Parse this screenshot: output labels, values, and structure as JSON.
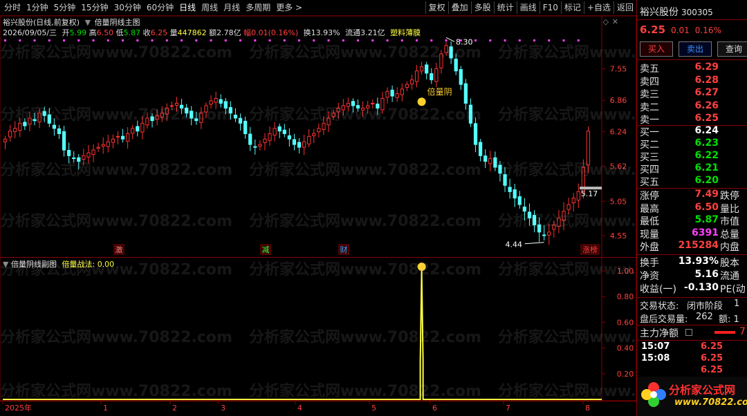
{
  "toolbar": {
    "periods": [
      "分时",
      "1分钟",
      "5分钟",
      "15分钟",
      "30分钟",
      "60分钟",
      "日线",
      "周线",
      "月线",
      "多周期",
      "更多 >"
    ],
    "active_period": "日线",
    "buttons": [
      "复权",
      "叠加",
      "多股",
      "统计",
      "画线",
      "F10",
      "标记",
      "+自选",
      "返回"
    ]
  },
  "main_chart": {
    "title": "裕兴股份(日线,前复权)",
    "indicator_title": "倍量阴线主图",
    "info": {
      "date": "2026/09/05/三",
      "open_label": "开",
      "open": "5.99",
      "high_label": "高",
      "high": "6.50",
      "low_label": "低",
      "low": "5.87",
      "close_label": "收",
      "close": "6.25",
      "volume_label": "量",
      "volume": "447862",
      "amount_label": "额",
      "amount": "2.78亿",
      "change_label": "幅",
      "change": "0.01(0.16%)",
      "turnover_label": "换",
      "turnover": "13.93%",
      "float_label": "流通",
      "float": "3.21亿",
      "concept": "塑料薄膜"
    },
    "y_ticks": [
      "7.55",
      "6.86",
      "6.24",
      "5.62",
      "5.05",
      "4.55"
    ],
    "annotations": {
      "high_mark": "8.30",
      "low_mark": "4.44",
      "signal_label": "倍量阴",
      "current_price_tag": "5.17"
    },
    "event_markers": [
      "激",
      "减",
      "财",
      "涨榜"
    ]
  },
  "sub_chart": {
    "title": "倍量阴线副图",
    "indicator_label": "倍量战法:",
    "indicator_value": "0.00",
    "y_ticks": [
      "1.00",
      "0.80",
      "0.60",
      "0.40",
      "0.20"
    ]
  },
  "x_axis": {
    "labels": [
      "2025年",
      "1",
      "2",
      "3",
      "4",
      "5",
      "6",
      "7",
      "8"
    ]
  },
  "right_panel": {
    "name": "裕兴股份",
    "code": "300305",
    "price": "6.25",
    "change": "0.01",
    "change_pct": "0.16%",
    "buy_label": "买入",
    "sell_label": "卖出",
    "query_label": "查询",
    "asks": [
      {
        "label": "卖五",
        "price": "6.29"
      },
      {
        "label": "卖四",
        "price": "6.28"
      },
      {
        "label": "卖三",
        "price": "6.27"
      },
      {
        "label": "卖二",
        "price": "6.26"
      },
      {
        "label": "卖一",
        "price": "6.25"
      }
    ],
    "bids": [
      {
        "label": "买一",
        "price": "6.24"
      },
      {
        "label": "买二",
        "price": "6.23"
      },
      {
        "label": "买三",
        "price": "6.22"
      },
      {
        "label": "买四",
        "price": "6.21"
      },
      {
        "label": "买五",
        "price": "6.20"
      }
    ],
    "stats": [
      {
        "label": "涨停",
        "value": "7.49",
        "label2": "跌停"
      },
      {
        "label": "最高",
        "value": "6.50",
        "label2": "量比"
      },
      {
        "label": "最低",
        "value": "5.87",
        "label2": "市值"
      },
      {
        "label": "现量",
        "value": "6391",
        "label2": "总量"
      },
      {
        "label": "外盘",
        "value": "215284",
        "label2": "内盘"
      }
    ],
    "stats2": [
      {
        "label": "换手",
        "value": "13.93%",
        "label2": "股本"
      },
      {
        "label": "净资",
        "value": "5.16",
        "label2": "流通"
      },
      {
        "label": "收益(一)",
        "value": "-0.130",
        "label2": "PE(动"
      }
    ],
    "trade_status_label": "交易状态:",
    "trade_status": "闭市阶段",
    "trade_status_tail": "1",
    "after_hours_label": "盘后交易量:",
    "after_hours_volume": "262",
    "after_hours_tail": "额: 1",
    "net_flow_label": "主力净额",
    "net_flow_tail": "7",
    "ticks": [
      {
        "time": "15:07",
        "price": "6.25"
      },
      {
        "time": "15:08",
        "price": "6.25"
      },
      {
        "time": "",
        "price": "6.25"
      }
    ],
    "logo_text": "分析家公式网",
    "logo_url": "www.70822.com"
  },
  "watermark": "分析家公式网www.70822.com",
  "chart_data": {
    "type": "candlestick",
    "title": "裕兴股份(日线,前复权)",
    "ylim": [
      4.3,
      8.5
    ],
    "y_scale": "log",
    "x_labels": [
      "2025年",
      "1",
      "2",
      "3",
      "4",
      "5",
      "6",
      "7",
      "8"
    ],
    "candles_close": [
      6.1,
      6.25,
      6.3,
      6.4,
      6.35,
      6.5,
      6.45,
      6.6,
      6.55,
      6.4,
      6.3,
      6.2,
      5.9,
      5.8,
      5.75,
      5.7,
      5.8,
      5.85,
      5.9,
      5.95,
      6.0,
      6.05,
      6.1,
      6.15,
      6.1,
      6.2,
      6.3,
      6.25,
      6.4,
      6.5,
      6.45,
      6.55,
      6.6,
      6.7,
      6.75,
      6.8,
      6.7,
      6.6,
      6.5,
      6.45,
      6.6,
      6.75,
      6.85,
      6.9,
      6.8,
      6.7,
      6.6,
      6.5,
      6.4,
      6.2,
      6.0,
      5.95,
      6.0,
      6.1,
      6.2,
      6.3,
      6.25,
      6.2,
      6.1,
      6.0,
      5.95,
      6.05,
      6.15,
      6.2,
      6.3,
      6.4,
      6.5,
      6.6,
      6.7,
      6.75,
      6.8,
      6.75,
      6.7,
      6.7,
      6.75,
      6.8,
      6.7,
      6.9,
      7.05,
      6.95,
      7.0,
      7.1,
      7.2,
      7.3,
      7.5,
      7.6,
      7.45,
      7.3,
      7.55,
      7.9,
      8.1,
      7.8,
      7.5,
      7.2,
      6.8,
      6.4,
      6.0,
      5.8,
      5.7,
      5.75,
      5.6,
      5.5,
      5.3,
      5.2,
      5.1,
      5.0,
      4.9,
      4.8,
      4.7,
      4.6,
      4.55,
      4.6,
      4.7,
      4.8,
      4.9,
      5.0,
      5.1,
      5.2,
      5.6,
      6.25
    ],
    "annotations": {
      "max": 8.3,
      "min": 4.44,
      "signal": "倍量阴"
    },
    "sub_series": {
      "name": "倍量战法",
      "ylim": [
        0,
        1.0
      ],
      "spike_index": 85,
      "spike_value": 1.0
    }
  }
}
